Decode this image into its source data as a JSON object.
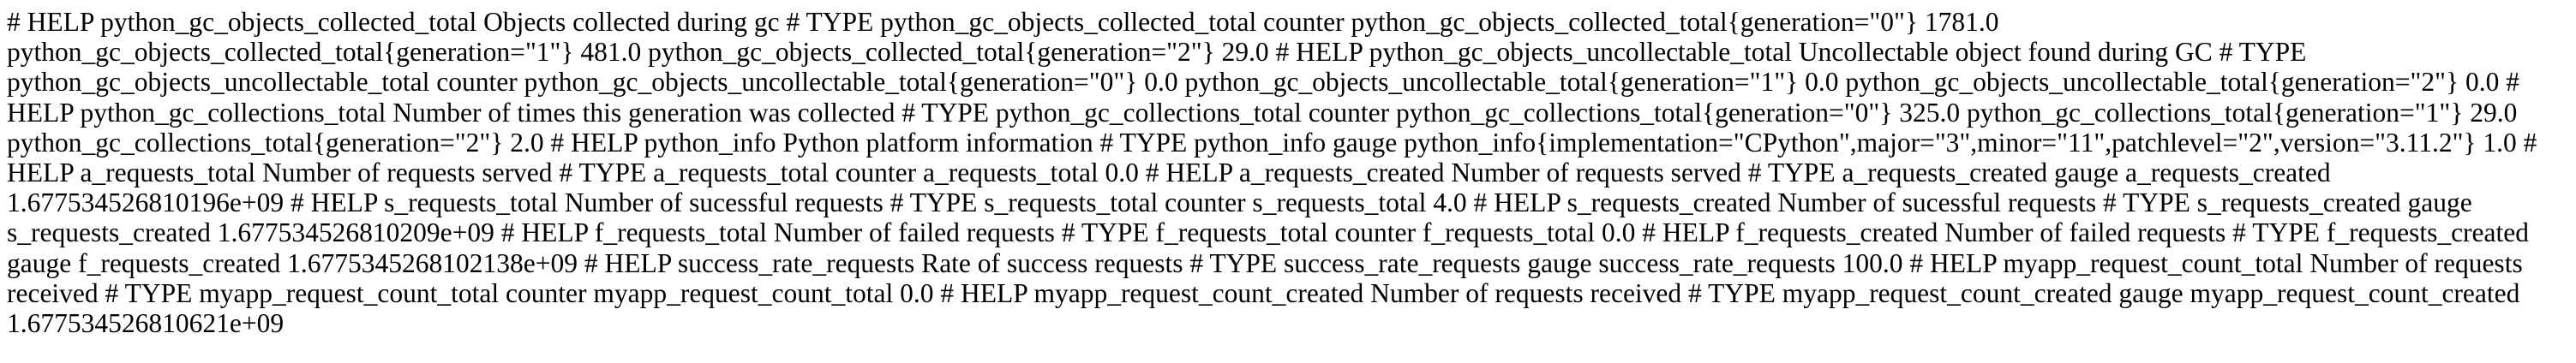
{
  "metrics_text": "# HELP python_gc_objects_collected_total Objects collected during gc # TYPE python_gc_objects_collected_total counter python_gc_objects_collected_total{generation=\"0\"} 1781.0 python_gc_objects_collected_total{generation=\"1\"} 481.0 python_gc_objects_collected_total{generation=\"2\"} 29.0 # HELP python_gc_objects_uncollectable_total Uncollectable object found during GC # TYPE python_gc_objects_uncollectable_total counter python_gc_objects_uncollectable_total{generation=\"0\"} 0.0 python_gc_objects_uncollectable_total{generation=\"1\"} 0.0 python_gc_objects_uncollectable_total{generation=\"2\"} 0.0 # HELP python_gc_collections_total Number of times this generation was collected # TYPE python_gc_collections_total counter python_gc_collections_total{generation=\"0\"} 325.0 python_gc_collections_total{generation=\"1\"} 29.0 python_gc_collections_total{generation=\"2\"} 2.0 # HELP python_info Python platform information # TYPE python_info gauge python_info{implementation=\"CPython\",major=\"3\",minor=\"11\",patchlevel=\"2\",version=\"3.11.2\"} 1.0 # HELP a_requests_total Number of requests served # TYPE a_requests_total counter a_requests_total 0.0 # HELP a_requests_created Number of requests served # TYPE a_requests_created gauge a_requests_created 1.677534526810196e+09 # HELP s_requests_total Number of sucessful requests # TYPE s_requests_total counter s_requests_total 4.0 # HELP s_requests_created Number of sucessful requests # TYPE s_requests_created gauge s_requests_created 1.677534526810209e+09 # HELP f_requests_total Number of failed requests # TYPE f_requests_total counter f_requests_total 0.0 # HELP f_requests_created Number of failed requests # TYPE f_requests_created gauge f_requests_created 1.6775345268102138e+09 # HELP success_rate_requests Rate of success requests # TYPE success_rate_requests gauge success_rate_requests 100.0 # HELP myapp_request_count_total Number of requests received # TYPE myapp_request_count_total counter myapp_request_count_total 0.0 # HELP myapp_request_count_created Number of requests received # TYPE myapp_request_count_created gauge myapp_request_count_created 1.677534526810621e+09"
}
